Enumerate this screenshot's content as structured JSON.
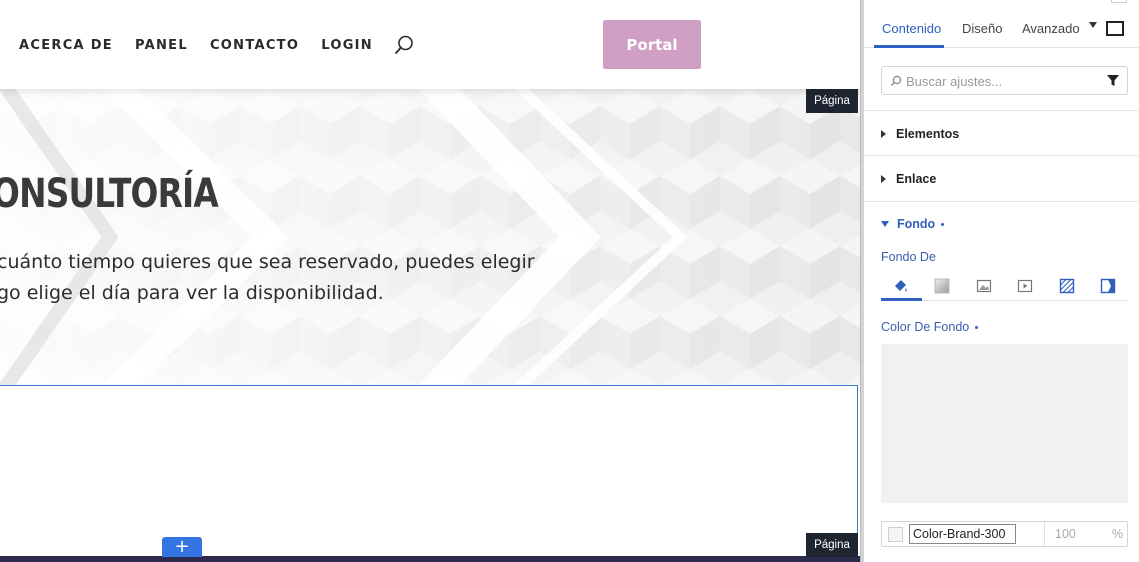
{
  "header": {
    "nav": [
      "ACERCA DE",
      "PANEL",
      "CONTACTO",
      "LOGIN"
    ],
    "portal_label": "Portal",
    "portal_color": "#cfa0c4"
  },
  "hero": {
    "title": "ONSULTORÍA",
    "line1": "cuánto tiempo quieres que sea reservado, puedes elegir",
    "line2": "go elige el día para ver la disponibilidad."
  },
  "canvas": {
    "page_tag_top": "Página",
    "page_tag_bottom": "Página",
    "add_label": "+"
  },
  "panel": {
    "tabs": [
      "Contenido",
      "Diseño",
      "Avanzado"
    ],
    "active_tab": "Contenido",
    "search_placeholder": "Buscar ajustes...",
    "sections": {
      "elementos": "Elementos",
      "enlace": "Enlace",
      "fondo": "Fondo"
    },
    "fondo_de_label": "Fondo De",
    "bg_types": [
      "fill-icon",
      "gradient-icon",
      "image-icon",
      "video-icon",
      "pattern-icon",
      "overlay-icon"
    ],
    "color_label": "Color De Fondo",
    "color_name": "Color-Brand-300",
    "opacity": "100",
    "opacity_unit": "%"
  },
  "colors": {
    "accent": "#2f5fbf",
    "selection": "#3f78d1",
    "footer": "#2e2a4d"
  }
}
